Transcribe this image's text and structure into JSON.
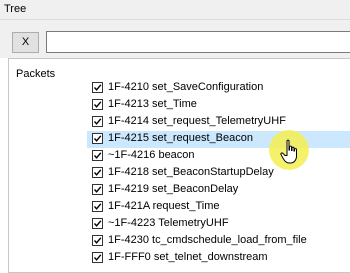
{
  "window": {
    "title": "Tree"
  },
  "filter": {
    "clear_label": "X",
    "value": "",
    "placeholder": ""
  },
  "tree": {
    "root_label": "Packets",
    "items": [
      {
        "label": "1F-4210 set_SaveConfiguration",
        "checked": true
      },
      {
        "label": "1F-4213 set_Time",
        "checked": true
      },
      {
        "label": "1F-4214 set_request_TelemetryUHF",
        "checked": true
      },
      {
        "label": "1F-4215 set_request_Beacon",
        "checked": true,
        "selected": true
      },
      {
        "label": "~1F-4216 beacon",
        "checked": true
      },
      {
        "label": "1F-4218 set_BeaconStartupDelay",
        "checked": true
      },
      {
        "label": "1F-4219 set_BeaconDelay",
        "checked": true
      },
      {
        "label": "1F-421A request_Time",
        "checked": true
      },
      {
        "label": "~1F-4223 TelemetryUHF",
        "checked": true
      },
      {
        "label": "1F-4230 tc_cmdschedule_load_from_file",
        "checked": true
      },
      {
        "label": "1F-FFF0 set_telnet_downstream",
        "checked": true
      }
    ]
  },
  "colors": {
    "selection": "#cce8ff",
    "cursor_highlight": "#f4ee50"
  },
  "cursor": {
    "icon": "hand-pointer-icon"
  }
}
